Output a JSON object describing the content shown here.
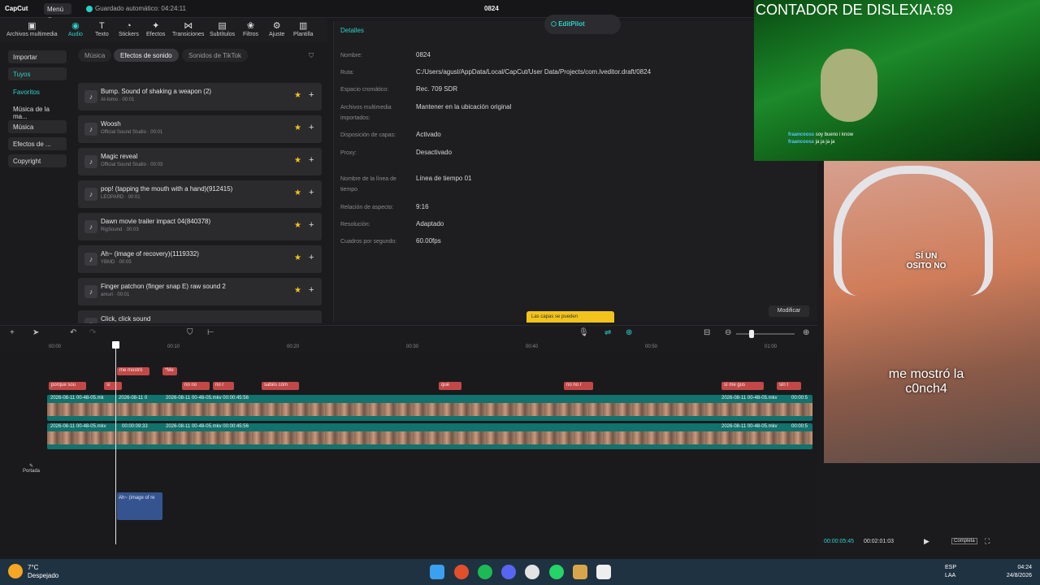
{
  "topbar": {
    "logo": "CapCut",
    "menu": "Menú",
    "autosave": "Guardado automático: 04:24:11",
    "project": "0824"
  },
  "toolbar": [
    "Archivos multimedia",
    "Audio",
    "Texto",
    "Stickers",
    "Efectos",
    "Transiciones",
    "Subtítulos",
    "Filtros",
    "Ajuste",
    "Plantilla"
  ],
  "leftnav": {
    "importar": "Importar",
    "tuyos": "Tuyos",
    "favoritos": "Favoritos",
    "musica_ma": "Música de la ma...",
    "musica": "Música",
    "efectos": "Efectos de ...",
    "copyright": "Copyright"
  },
  "soundtabs": {
    "musica": "Música",
    "efectos": "Efectos de sonido",
    "tiktok": "Sonidos de TikTok"
  },
  "sounds": [
    {
      "title": "Bump. Sound of shaking a weapon (2)",
      "sub": "AI-tomo · 00:01"
    },
    {
      "title": "Woosh",
      "sub": "Official Sound Studio · 00:01"
    },
    {
      "title": "Magic reveal",
      "sub": "Official Sound Studio · 00:03"
    },
    {
      "title": "pop! (tapping the mouth with a hand)(912415)",
      "sub": "LEOPARD · 00:01"
    },
    {
      "title": "Dawn movie trailer impact 04(840378)",
      "sub": "RigSound · 00:03"
    },
    {
      "title": "Ah~ (image of recovery)(1119332)",
      "sub": "YBMD · 00:05"
    },
    {
      "title": "Finger patchon (finger snap E) raw sound 2",
      "sub": "amuri · 00:01"
    },
    {
      "title": "Click, click sound",
      "sub": ""
    }
  ],
  "details": {
    "title": "Detalles",
    "rows": [
      {
        "label": "Nombre:",
        "value": "0824"
      },
      {
        "label": "Ruta:",
        "value": "C:/Users/agusl/AppData/Local/CapCut/User Data/Projects/com.lveditor.draft/0824"
      },
      {
        "label": "Espacio cromático:",
        "value": "Rec. 709 SDR"
      },
      {
        "label": "Archivos multimedia importados:",
        "value": "Mantener en la ubicación original"
      },
      {
        "label": "Disposición de capas:",
        "value": "Activado"
      },
      {
        "label": "Proxy:",
        "value": "Desactivado"
      },
      {
        "label": "Nombre de la línea de tiempo",
        "value": "Línea de tiempo 01"
      },
      {
        "label": "Relación de aspecto:",
        "value": "9:16"
      },
      {
        "label": "Resolución:",
        "value": "Adaptado"
      },
      {
        "label": "Cuadros por segundo:",
        "value": "60.00fps"
      }
    ],
    "modify": "Modificar",
    "tip": "Las capas se pueden"
  },
  "editpilot": "EditPilot",
  "ruler": [
    "00:00",
    "00:10",
    "00:20",
    "00:30",
    "00:40",
    "00:50",
    "01:00"
  ],
  "timeline": {
    "labels_top": [
      "me mostró",
      "*Me"
    ],
    "labels_mid": [
      "porque sou",
      "sí",
      "no no",
      "no r",
      "sabés cóm",
      "qué",
      "no no r",
      "sí me gus",
      "sin t"
    ],
    "track1": [
      "2026-08-11 00-48-05.mk",
      "2026-08-11 0",
      "2026-08-11 00-48-05.mkv 00:00:45:56",
      "2026-08-11 00-48-05.mkv",
      "00:00:5"
    ],
    "track2": [
      "2026-08-11 00-48-05.mkv",
      "00:00:09:33",
      "2026-08-11 00-48-05.mkv 00:00:45:56",
      "2026-08-11 00-48-05.mkv",
      "00:00:5"
    ],
    "portada": "Portada",
    "audio": "Ah~ (image of re"
  },
  "preview": {
    "current": "00:00:05:45",
    "total": "00:02:01:03",
    "full": "Completa"
  },
  "stream": {
    "title": "CONTADOR DE DISLEXIA:69",
    "chat": [
      {
        "user": "fraancooss",
        "msg": "soy bueno i know"
      },
      {
        "user": "fraancooss",
        "msg": "ja ja ja ja"
      }
    ],
    "caption1": "SÍ UN OSITO NO",
    "caption2": "me mostró la c0nch4"
  },
  "taskbar": {
    "temp": "7°C",
    "weather": "Despejado",
    "lang1": "ESP",
    "lang2": "LAA",
    "time": "04:24",
    "date": "24/8/2026"
  }
}
